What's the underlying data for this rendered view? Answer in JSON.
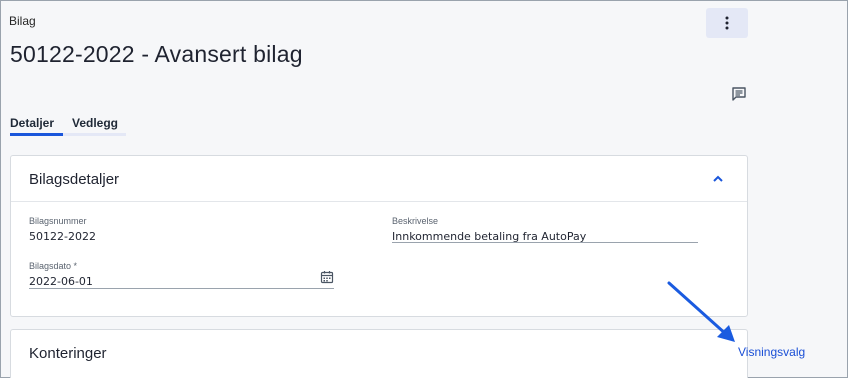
{
  "header": {
    "breadcrumb": "Bilag",
    "title": "50122-2022 - Avansert bilag",
    "more_icon": "kebab-vertical-icon",
    "comment_icon": "comment-icon"
  },
  "tabs": [
    {
      "label": "Detaljer",
      "active": true
    },
    {
      "label": "Vedlegg",
      "active": false
    }
  ],
  "details_card": {
    "title": "Bilagsdetaljer",
    "collapse_icon": "chevron-up-icon",
    "fields": {
      "bilagsnummer": {
        "label": "Bilagsnummer",
        "value": "50122-2022"
      },
      "beskrivelse": {
        "label": "Beskrivelse",
        "value": "Innkommende betaling fra AutoPay"
      },
      "bilagsdato": {
        "label": "Bilagsdato *",
        "value": "2022-06-01",
        "icon": "calendar-icon"
      }
    }
  },
  "konteringer_card": {
    "title": "Konteringer",
    "link_label": "Visningsvalg"
  },
  "colors": {
    "accent": "#1a56db",
    "link": "#1a4fd6",
    "annotation_arrow": "#1a5be0"
  }
}
